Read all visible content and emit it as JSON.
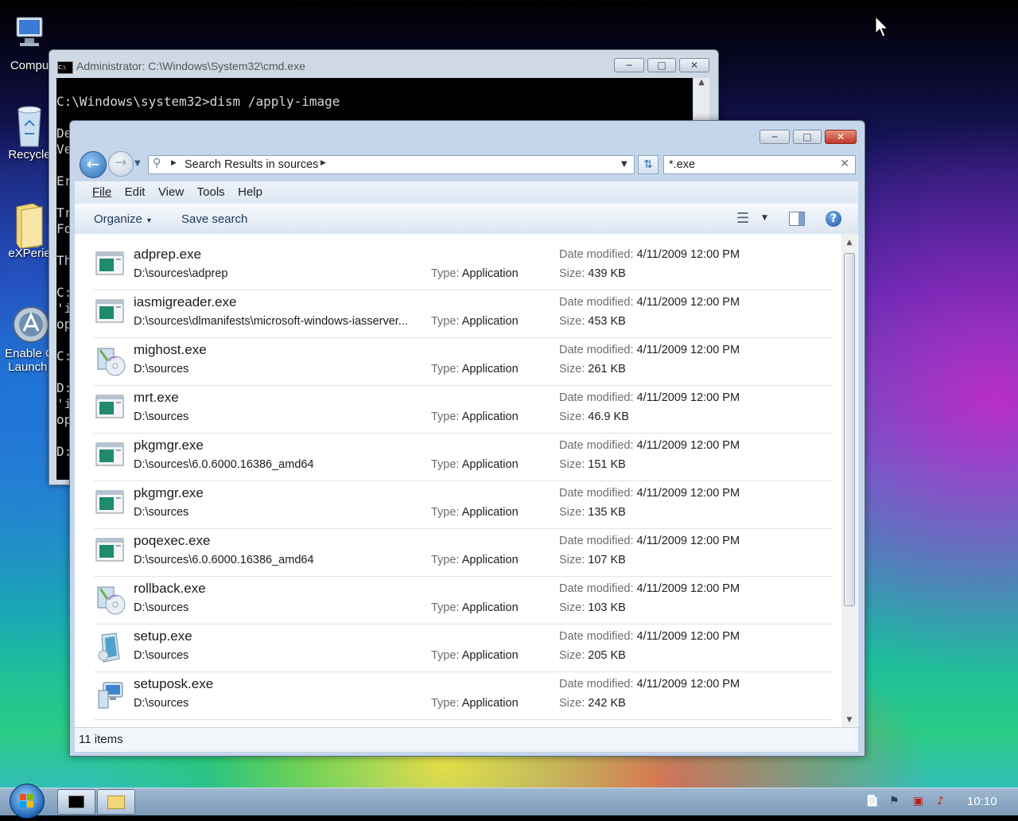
{
  "desktop": {
    "icons": [
      {
        "label": "Compu",
        "icon": "computer-icon"
      },
      {
        "label": "Recycle",
        "icon": "recycle-bin-icon"
      },
      {
        "label": "eXPerie",
        "icon": "folder-icon"
      },
      {
        "label1": "Enable C",
        "label2": "Launch.",
        "icon": "launcher-icon"
      }
    ]
  },
  "cmd": {
    "title": "Administrator: C:\\Windows\\System32\\cmd.exe",
    "lines": [
      "C:\\Windows\\system32>dism /apply-image",
      "",
      "De",
      "Ve",
      "",
      "Er",
      "",
      "Tr",
      "Fo",
      "",
      "Th",
      "",
      "C:",
      "'i",
      "op",
      "",
      "C:",
      "",
      "D:",
      "'i",
      "op",
      "",
      "D:"
    ]
  },
  "explorer": {
    "address": {
      "breadcrumb": "Search Results in sources"
    },
    "search": {
      "value": "*.exe"
    },
    "menu": [
      "File",
      "Edit",
      "View",
      "Tools",
      "Help"
    ],
    "toolbar": {
      "organize": "Organize",
      "save_search": "Save search"
    },
    "labels": {
      "type": "Type:",
      "date_modified": "Date modified:",
      "size": "Size:"
    },
    "files": [
      {
        "name": "adprep.exe",
        "path": "D:\\sources\\adprep",
        "type": "Application",
        "date": "4/11/2009 12:00 PM",
        "size": "439 KB",
        "icon": "app-window-icon"
      },
      {
        "name": "iasmigreader.exe",
        "path": "D:\\sources\\dlmanifests\\microsoft-windows-iasserver...",
        "type": "Application",
        "date": "4/11/2009 12:00 PM",
        "size": "453 KB",
        "icon": "app-window-icon"
      },
      {
        "name": "mighost.exe",
        "path": "D:\\sources",
        "type": "Application",
        "date": "4/11/2009 12:00 PM",
        "size": "261 KB",
        "icon": "setup-cd-icon"
      },
      {
        "name": "mrt.exe",
        "path": "D:\\sources",
        "type": "Application",
        "date": "4/11/2009 12:00 PM",
        "size": "46.9 KB",
        "icon": "app-window-icon"
      },
      {
        "name": "pkgmgr.exe",
        "path": "D:\\sources\\6.0.6000.16386_amd64",
        "type": "Application",
        "date": "4/11/2009 12:00 PM",
        "size": "151 KB",
        "icon": "app-window-icon"
      },
      {
        "name": "pkgmgr.exe",
        "path": "D:\\sources",
        "type": "Application",
        "date": "4/11/2009 12:00 PM",
        "size": "135 KB",
        "icon": "app-window-icon"
      },
      {
        "name": "poqexec.exe",
        "path": "D:\\sources\\6.0.6000.16386_amd64",
        "type": "Application",
        "date": "4/11/2009 12:00 PM",
        "size": "107 KB",
        "icon": "app-window-icon"
      },
      {
        "name": "rollback.exe",
        "path": "D:\\sources",
        "type": "Application",
        "date": "4/11/2009 12:00 PM",
        "size": "103 KB",
        "icon": "setup-cd-icon"
      },
      {
        "name": "setup.exe",
        "path": "D:\\sources",
        "type": "Application",
        "date": "4/11/2009 12:00 PM",
        "size": "205 KB",
        "icon": "setup-icon"
      },
      {
        "name": "setuposk.exe",
        "path": "D:\\sources",
        "type": "Application",
        "date": "4/11/2009 12:00 PM",
        "size": "242 KB",
        "icon": "setup-monitor-icon"
      }
    ],
    "status": "11 items"
  },
  "taskbar": {
    "clock": "10:10"
  }
}
